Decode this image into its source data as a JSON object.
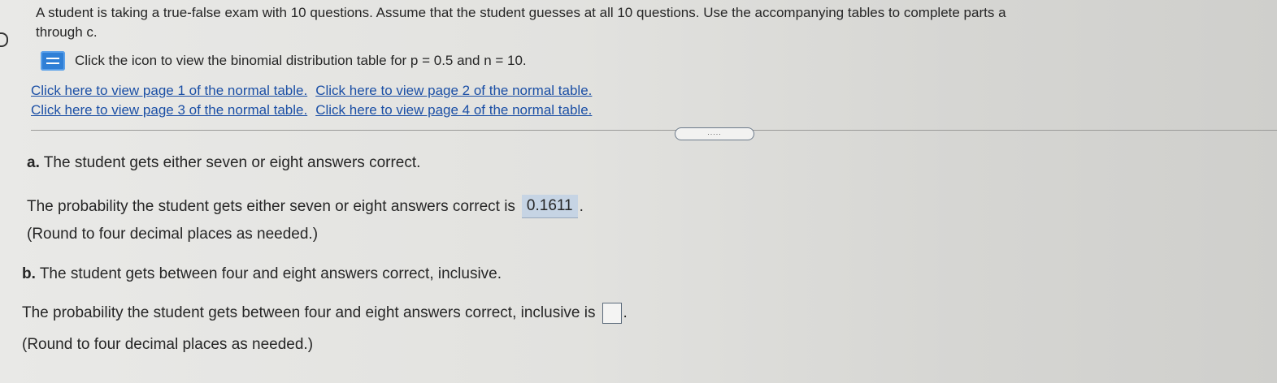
{
  "intro": {
    "line1": "A student is taking a true-false exam with 10 questions. Assume that the student guesses at all 10 questions. Use the accompanying tables to complete parts a",
    "line2": "through c."
  },
  "table_link": {
    "icon": "table-icon",
    "text": "Click the icon to view the binomial distribution table for p = 0.5 and n = 10."
  },
  "normal_links": [
    "Click here to view page 1 of the normal table.",
    "Click here to view page 2 of the normal table.",
    "Click here to view page 3 of the normal table.",
    "Click here to view page 4 of the normal table."
  ],
  "more_button": ".....",
  "part_a": {
    "label": "a.",
    "question": "The student gets either seven or eight answers correct.",
    "answer_prompt": "The probability the student gets either seven or eight answers correct is",
    "answer_value": "0.1611",
    "round_note": "(Round to four decimal places as needed.)"
  },
  "part_b": {
    "label": "b.",
    "question": "The student gets between four and eight answers correct, inclusive.",
    "answer_prompt": "The probability the student gets between four and eight answers correct, inclusive is",
    "answer_value": "",
    "round_note": "(Round to four decimal places as needed.)"
  },
  "colors": {
    "link": "#1b4fa5",
    "answer_highlight": "#c6d4e4",
    "icon_blue": "#2f7fd6"
  }
}
